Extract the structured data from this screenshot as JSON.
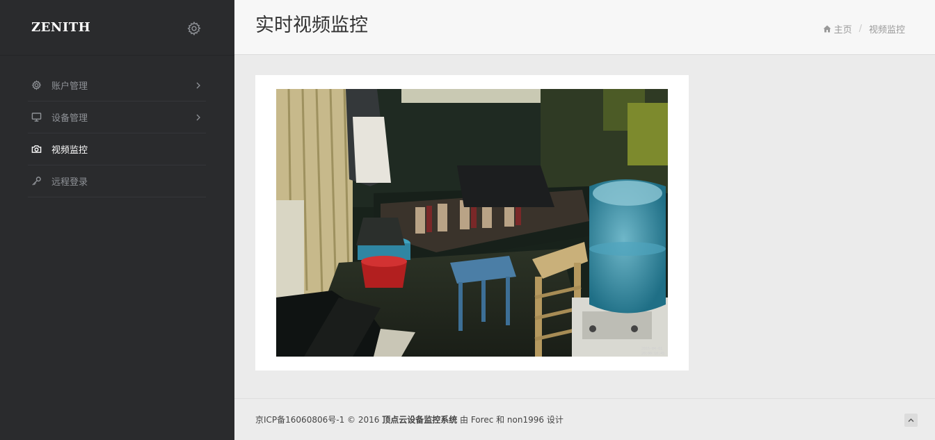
{
  "brand": {
    "name": "ZENITH"
  },
  "sidebar": {
    "items": [
      {
        "label": "账户管理",
        "icon": "gear-icon"
      },
      {
        "label": "设备管理",
        "icon": "monitor-icon"
      },
      {
        "label": "视频监控",
        "icon": "camera-icon",
        "active": true
      },
      {
        "label": "远程登录",
        "icon": "key-icon"
      }
    ]
  },
  "header": {
    "title": "实时视频监控",
    "breadcrumb": {
      "home": "主页",
      "current": "视频监控"
    }
  },
  "video": {
    "timestamp_line1": "2016-04-01",
    "timestamp_line2": "20:00:10:45"
  },
  "footer": {
    "prefix": "京ICP备16060806号-1 © 2016 ",
    "system_name": "顶点云设备监控系统",
    "by": " 由 Forec 和 non1996 设计"
  },
  "colors": {
    "sidebar_bg": "#2a2b2d",
    "header_bg": "#f7f7f7",
    "content_bg": "#ebebeb"
  }
}
